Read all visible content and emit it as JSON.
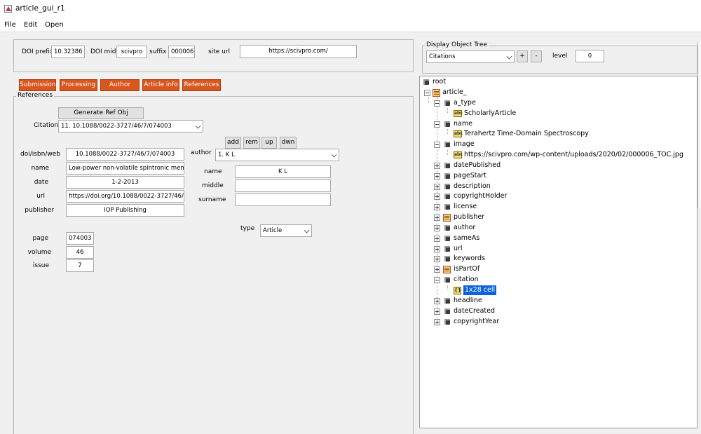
{
  "window": {
    "title": "article_gui_r1"
  },
  "menu": [
    "File",
    "Edit",
    "Open"
  ],
  "doi": {
    "prefix_label": "DOI prefix",
    "prefix_value": "10.32386",
    "mid_label": "DOI mid",
    "mid_value": "scivpro",
    "suffix_label": "suffix",
    "suffix_value": "000006",
    "site_label": "site url",
    "site_value": "https://scivpro.com/"
  },
  "tabs": [
    "Submission",
    "Processing",
    "Author",
    "Article info",
    "References"
  ],
  "references": {
    "group_label": "References",
    "generate_button": "Generate Ref Obj",
    "citation_label": "Citation",
    "citation_value": "11. 10.1088/0022-3727/46/7/074003",
    "fields": [
      {
        "label": "doi/isbn/web",
        "value": "10.1088/0022-3727/46/7/074003"
      },
      {
        "label": "name",
        "value": "Low-power non-volatile spintronic memor"
      },
      {
        "label": "date",
        "value": "1-2-2013"
      },
      {
        "label": "url",
        "value": "https://doi.org/10.1088/0022-3727/46/7/07"
      },
      {
        "label": "publisher",
        "value": "IOP Publishing"
      }
    ],
    "author_buttons": [
      "add",
      "rem",
      "up",
      "dwn"
    ],
    "author_label": "author",
    "author_value": "1. K L",
    "author_fields": [
      {
        "label": "name",
        "value": "K L"
      },
      {
        "label": "middle",
        "value": ""
      },
      {
        "label": "surname",
        "value": ""
      }
    ],
    "page_fields": [
      {
        "label": "page",
        "value": "074003"
      },
      {
        "label": "volume",
        "value": "46"
      },
      {
        "label": "issue",
        "value": "7"
      }
    ],
    "type_label": "type",
    "type_value": "Article"
  },
  "display_tree": {
    "group_label": "Display Object Tree",
    "combo_value": "Citations",
    "plus": "+",
    "minus": "-",
    "level_label": "level",
    "level_value": "0"
  },
  "tree": {
    "root": "root",
    "article": "article_",
    "a_type": "a_type",
    "a_type_value": "ScholarlyArticle",
    "name": "name",
    "name_value": "Terahertz Time-Domain Spectroscopy",
    "image": "image",
    "image_value": "https://scivpro.com/wp-content/uploads/2020/02/000006_TOC.jpg",
    "datePublished": "datePublished",
    "pageStart": "pageStart",
    "description": "description",
    "copyrightHolder": "copyrightHolder",
    "license": "license",
    "publisher": "publisher",
    "author": "author",
    "sameAs": "sameAs",
    "url": "url",
    "keywords": "keywords",
    "isPartOf": "isPartOf",
    "citation": "citation",
    "citation_value": "1x28 cell",
    "headline": "headline",
    "dateCreated": "dateCreated",
    "copyrightYear": "copyrightYear"
  },
  "colors": {
    "tab": "#d9561f",
    "selection": "#0a64d8"
  }
}
